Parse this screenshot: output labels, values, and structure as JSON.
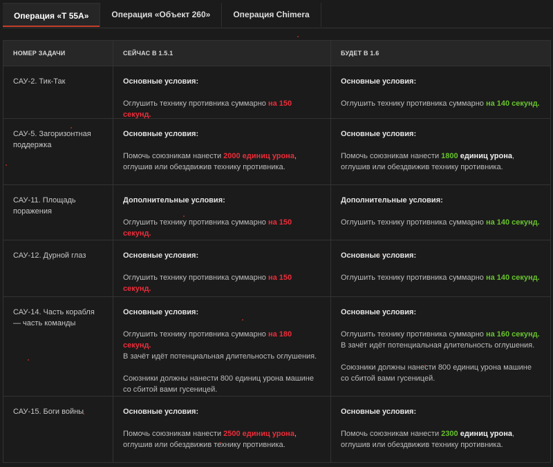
{
  "tabs": [
    {
      "label": "Операция «Т 55А»",
      "active": true
    },
    {
      "label": "Операция «Объект 260»",
      "active": false
    },
    {
      "label": "Операция Chimera",
      "active": false
    }
  ],
  "table": {
    "headers": [
      "НОМЕР ЗАДАЧИ",
      "СЕЙЧАС В 1.5.1",
      "БУДЕТ В 1.6"
    ],
    "rows": [
      {
        "task": "САУ-2. Тик-Так",
        "now": {
          "title": "Основные условия:",
          "pre": "Оглушить технику противника суммарно ",
          "hl": "на 150 секунд.",
          "post": ""
        },
        "next": {
          "title": "Основные условия:",
          "pre": "Оглушить технику противника суммарно ",
          "hl": "на 140 секунд.",
          "post": ""
        }
      },
      {
        "task": "САУ-5. Загоризонтная поддержка",
        "now": {
          "title": "Основные условия:",
          "pre": "Помочь союзникам нанести ",
          "hl": "2000 единиц урона",
          "post": ",",
          "post2": "оглушив или обездвижив технику противника."
        },
        "next": {
          "title": "Основные условия:",
          "pre": "Помочь союзникам нанести ",
          "hl": "1800",
          "hl2": " единиц урона",
          "post": ",",
          "post2": "оглушив или обездвижив технику противника."
        }
      },
      {
        "task": "САУ-11. Площадь поражения",
        "now": {
          "title": "Дополнительные условия:",
          "pre": "Оглушить технику противника суммарно ",
          "hl": "на 150 секунд.",
          "post": ""
        },
        "next": {
          "title": "Дополнительные условия:",
          "pre": "Оглушить технику противника суммарно ",
          "hl": "на 140 секунд.",
          "post": ""
        }
      },
      {
        "task": "САУ-12. Дурной глаз",
        "now": {
          "title": "Основные условия:",
          "pre": "Оглушить технику противника суммарно ",
          "hl": "на 150 секунд.",
          "post": ""
        },
        "next": {
          "title": "Основные условия:",
          "pre": "Оглушить технику противника суммарно ",
          "hl": "на 140 секунд.",
          "post": ""
        }
      },
      {
        "task": "САУ-14. Часть корабля — часть команды",
        "now": {
          "title": "Основные условия:",
          "pre": "Оглушить технику противника суммарно ",
          "hl": "на 180 секунд.",
          "post": "",
          "post2": "В зачёт идёт потенциальная длительность оглушения.",
          "extra": "Союзники должны нанести 800 единиц урона машине со сбитой вами гусеницей."
        },
        "next": {
          "title": "Основные условия:",
          "pre": "Оглушить технику противника суммарно ",
          "hl": "на 160 секунд.",
          "post": "",
          "post2": "В зачёт идёт потенциальная длительность оглушения.",
          "extra": "Союзники должны нанести 800 единиц урона машине со сбитой вами гусеницей."
        }
      },
      {
        "task": "САУ-15. Боги войны",
        "now": {
          "title": "Основные условия:",
          "pre": "Помочь союзникам нанести ",
          "hl": "2500 единиц урона",
          "post": ",",
          "post2": "оглушив или обездвижив технику противника."
        },
        "next": {
          "title": "Основные условия:",
          "pre": "Помочь союзникам нанести ",
          "hl": "2300",
          "hl2": " единиц урона",
          "post": ",",
          "post2": "оглушив или обездвижив технику противника."
        }
      }
    ]
  },
  "colors": {
    "decrease_old": "#ea2d3a",
    "decrease_new": "#68c22e",
    "tab_accent": "#c5402b"
  }
}
